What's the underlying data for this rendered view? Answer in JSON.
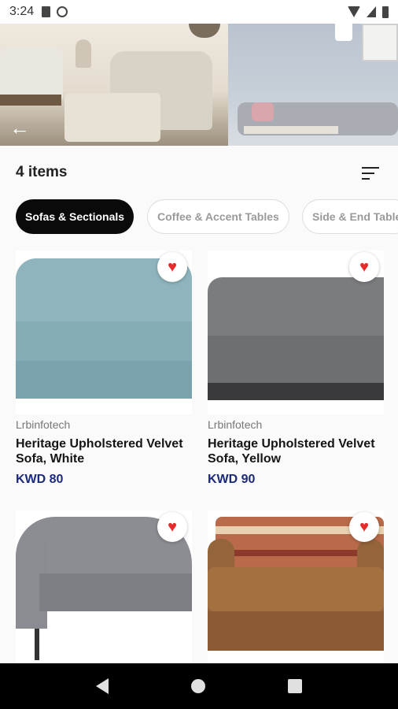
{
  "status_bar": {
    "time": "3:24",
    "icons": [
      "sd-card-icon",
      "g-icon",
      "wifi-icon",
      "signal-icon",
      "battery-icon"
    ]
  },
  "banner": {
    "back_icon": "←"
  },
  "header": {
    "items_count": "4 items",
    "sort_icon": "sort-icon"
  },
  "categories": [
    {
      "label": "Sofas & Sectionals",
      "active": true
    },
    {
      "label": "Coffee & Accent Tables",
      "active": false
    },
    {
      "label": "Side & End Table",
      "active": false
    }
  ],
  "products": [
    {
      "brand": "Lrbinfotech",
      "title": "Heritage Upholstered Velvet Sofa, White",
      "price": "KWD 80",
      "favorite": true,
      "fav_icon": "♥"
    },
    {
      "brand": "Lrbinfotech",
      "title": "Heritage Upholstered Velvet Sofa, Yellow",
      "price": "KWD 90",
      "favorite": true,
      "fav_icon": "♥"
    },
    {
      "favorite": true,
      "fav_icon": "♥"
    },
    {
      "favorite": true,
      "fav_icon": "♥"
    }
  ],
  "colors": {
    "accent": "#0a0a0a",
    "price": "#1d2a7a",
    "favorite": "#e52b2b"
  }
}
